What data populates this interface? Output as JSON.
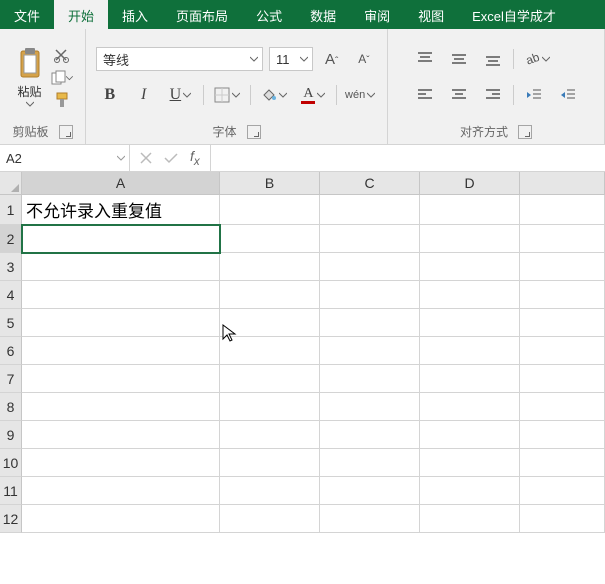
{
  "tabs": [
    "文件",
    "开始",
    "插入",
    "页面布局",
    "公式",
    "数据",
    "审阅",
    "视图",
    "Excel自学成才"
  ],
  "active_tab_index": 1,
  "clipboard": {
    "paste_label": "粘贴",
    "group_label": "剪贴板"
  },
  "font": {
    "name": "等线",
    "size": "11",
    "group_label": "字体",
    "bold": "B",
    "italic": "I",
    "underline": "U",
    "pinyin": "wén",
    "increase": "A",
    "decrease": "A",
    "fontcolor_bar": "#c00000",
    "fillcolor_bar": "#ffff00"
  },
  "align": {
    "group_label": "对齐方式"
  },
  "namebox": "A2",
  "formula": "",
  "columns": [
    "A",
    "B",
    "C",
    "D",
    ""
  ],
  "rows": [
    "1",
    "2",
    "3",
    "4",
    "5",
    "6",
    "7",
    "8",
    "9",
    "10",
    "11",
    "12"
  ],
  "cells": {
    "A1": "不允许录入重复值"
  },
  "selected": {
    "row": 2,
    "col": "A"
  },
  "chart_data": null
}
